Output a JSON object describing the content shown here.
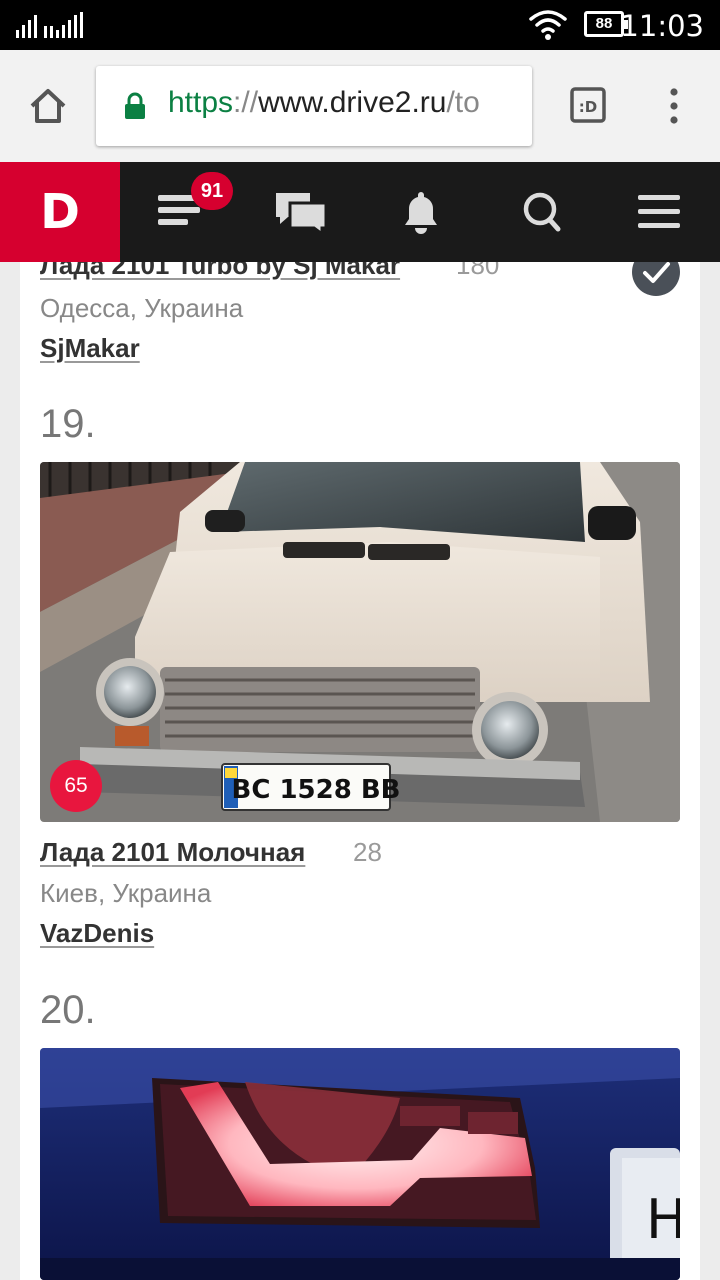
{
  "status": {
    "time": "11:03",
    "battery": "88"
  },
  "browser": {
    "url_scheme": "https",
    "url_sep": "://",
    "url_host": "www.drive2.ru",
    "url_path": "/to"
  },
  "site": {
    "logo": "D",
    "messages_badge": "91"
  },
  "entries": [
    {
      "title": "Лада 2101 Turbo by Sj Makar",
      "count": "180",
      "location": "Одесса, Украина",
      "user": "SjMakar"
    },
    {
      "rank": "19.",
      "badge": "65",
      "title": "Лада 2101 Молочная",
      "count": "28",
      "location": "Киев, Украина",
      "user": "VazDenis",
      "plate": "BC 1528 BB"
    },
    {
      "rank": "20."
    }
  ],
  "colors": {
    "brand": "#d6002f",
    "header": "#1a1a1a",
    "secure": "#0b8043"
  }
}
